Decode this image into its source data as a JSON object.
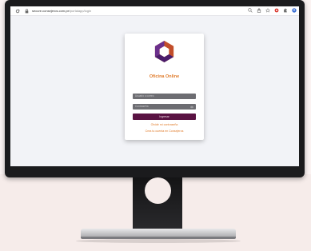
{
  "browser": {
    "url_domain": "secure.consejeros.com.pe",
    "url_path": "/portalapp/login",
    "icons": [
      "reload-icon",
      "lock-icon",
      "zoom-icon",
      "share-icon",
      "star-icon",
      "extension-icon",
      "puzzle-icon",
      "profile-icon"
    ]
  },
  "login": {
    "title": "Oficina Online",
    "username_placeholder": "Usuario o correo",
    "password_placeholder": "Contraseña",
    "submit_label": "Ingresar",
    "forgot_link": "Olvidé mi contraseña",
    "create_link": "Crea tu cuenta en Consejeros"
  },
  "colors": {
    "accent": "#e07b2a",
    "button": "#5a1343",
    "field": "#6d6d72",
    "logo_purple": "#6b2f8c",
    "logo_orange": "#f08a2c"
  }
}
